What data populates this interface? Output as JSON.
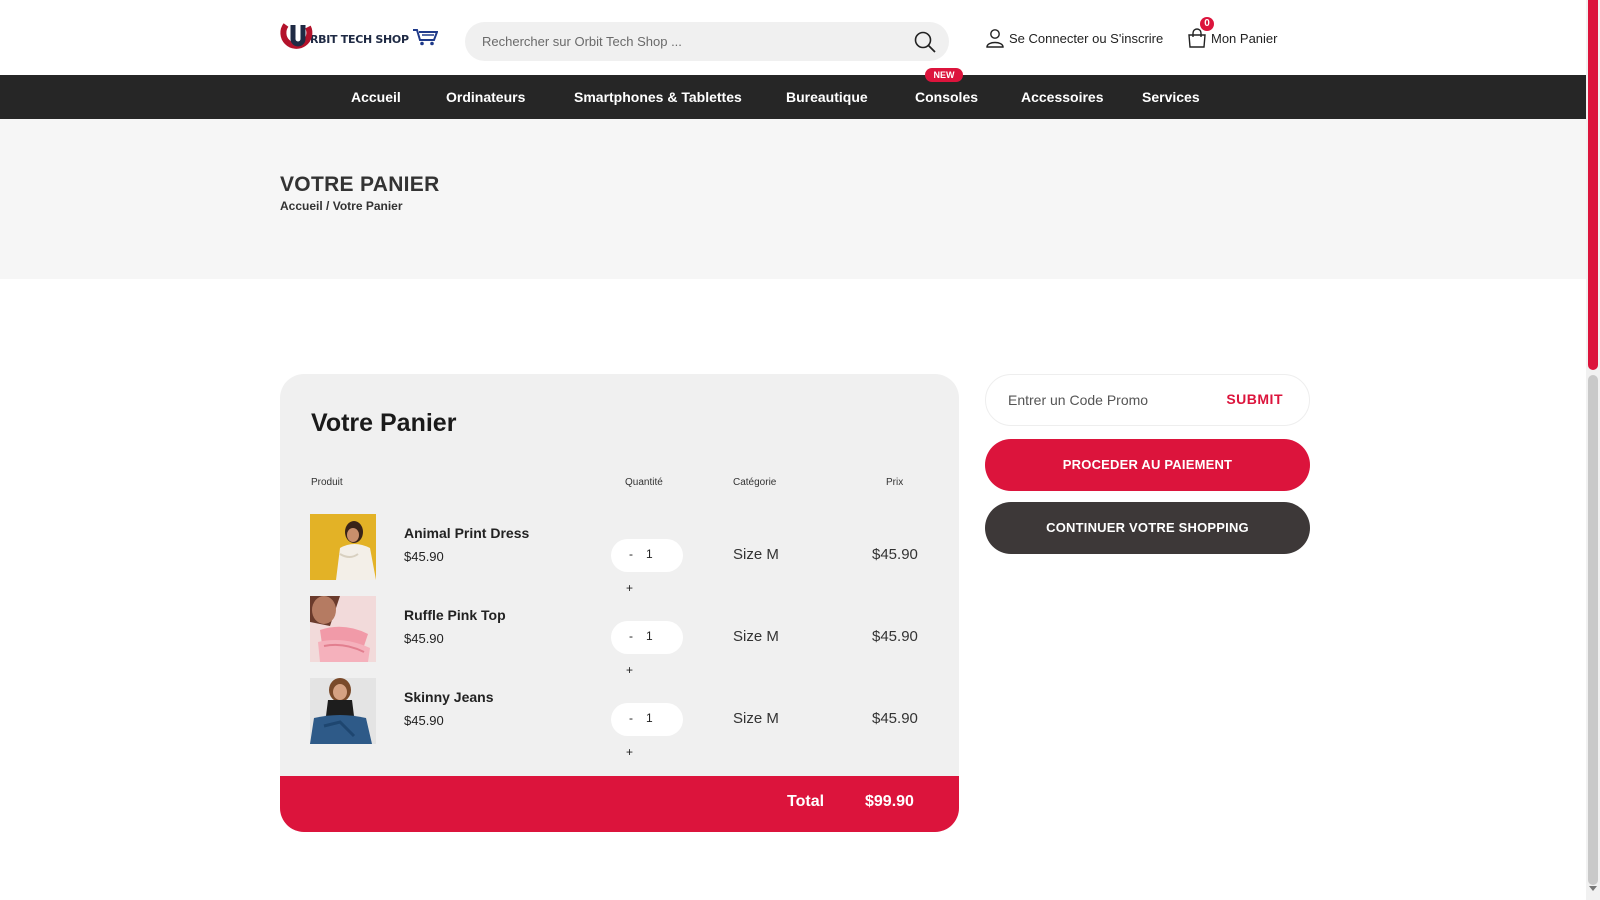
{
  "header": {
    "logo_text": "RBIT TECH SHOP",
    "search_placeholder": "Rechercher sur Orbit Tech Shop ...",
    "login_label": "Se Connecter ou S'inscrire",
    "cart_label": "Mon Panier",
    "cart_count": "0"
  },
  "nav": {
    "items": [
      {
        "label": "Accueil"
      },
      {
        "label": "Ordinateurs"
      },
      {
        "label": "Smartphones & Tablettes"
      },
      {
        "label": "Bureautique"
      },
      {
        "label": "Consoles"
      },
      {
        "label": "Accessoires"
      },
      {
        "label": "Services"
      }
    ],
    "badge": "NEW"
  },
  "banner": {
    "title": "VOTRE PANIER",
    "breadcrumb_home": "Accueil",
    "breadcrumb_sep": " / ",
    "breadcrumb_current": "Votre Panier"
  },
  "cart": {
    "title": "Votre Panier",
    "columns": {
      "product": "Produit",
      "quantity": "Quantité",
      "category": "Catégorie",
      "price": "Prix"
    },
    "items": [
      {
        "name": "Animal Print Dress",
        "price": "$45.90",
        "qty": "1",
        "category": "Size M",
        "line_price": "$45.90"
      },
      {
        "name": "Ruffle Pink Top",
        "price": "$45.90",
        "qty": "1",
        "category": "Size M",
        "line_price": "$45.90"
      },
      {
        "name": "Skinny Jeans",
        "price": "$45.90",
        "qty": "1",
        "category": "Size M",
        "line_price": "$45.90"
      }
    ],
    "minus": "-",
    "plus": "+",
    "total_label": "Total",
    "total_value": "$99.90"
  },
  "promo": {
    "placeholder": "Entrer un Code Promo",
    "submit": "SUBMIT"
  },
  "buttons": {
    "pay": "PROCEDER AU PAIEMENT",
    "continue": "CONTINUER VOTRE SHOPPING"
  },
  "colors": {
    "accent": "#dc143c",
    "nav_bg": "#262626",
    "dark_button": "#3d3838"
  }
}
